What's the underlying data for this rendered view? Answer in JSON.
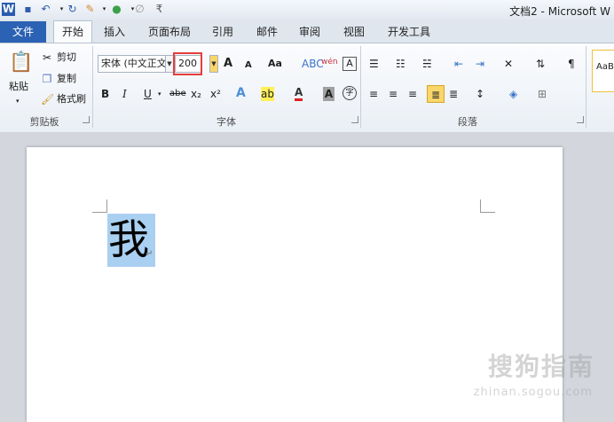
{
  "title_bar": {
    "app_icon": "W",
    "document_title": "文档2 - Microsoft W"
  },
  "quick_access": [
    "save-icon",
    "undo-icon",
    "redo-icon",
    "format-icon",
    "color-icon",
    "draw-icon",
    "customize-icon"
  ],
  "tabs": [
    "文件",
    "开始",
    "插入",
    "页面布局",
    "引用",
    "邮件",
    "审阅",
    "视图",
    "开发工具"
  ],
  "active_tab": "开始",
  "clipboard": {
    "paste_label": "粘贴",
    "cut_label": "剪切",
    "copy_label": "复制",
    "format_painter_label": "格式刷",
    "group_label": "剪贴板"
  },
  "font": {
    "font_name": "宋体 (中文正文",
    "font_size": "200",
    "highlight_color": "#e63d3d",
    "grow": "A",
    "shrink": "A",
    "change_case": "Aa",
    "bold": "B",
    "italic": "I",
    "underline": "U",
    "strike": "abe",
    "subscript": "x₂",
    "superscript": "x²",
    "text_effect": "A",
    "highlighter": "ab",
    "font_color": "A",
    "char_shading": "A",
    "enclose": "字",
    "phonetic": "wén",
    "char_border": "A",
    "group_label": "字体"
  },
  "paragraph": {
    "group_label": "段落"
  },
  "styles": {
    "preview": "AaB"
  },
  "document": {
    "text": "我"
  },
  "watermark": {
    "text": "搜狗指南",
    "url": "zhinan.sogou.com"
  }
}
